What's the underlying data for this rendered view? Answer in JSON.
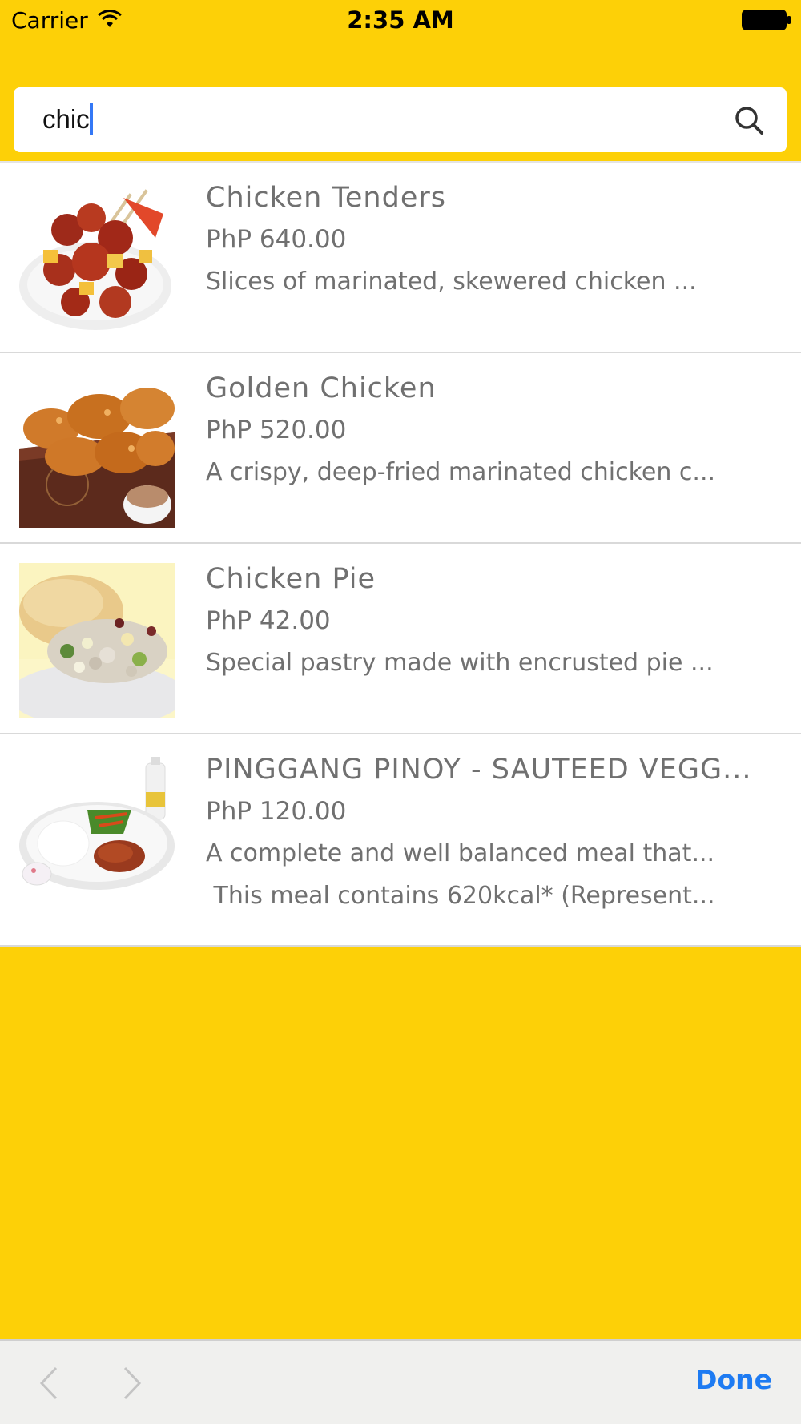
{
  "status_bar": {
    "carrier": "Carrier",
    "time": "2:35 AM"
  },
  "search": {
    "query": "chic",
    "icon": "search-icon"
  },
  "results": [
    {
      "name": "Chicken Tenders",
      "price": "PhP 640.00",
      "desc": [
        "Slices of marinated, skewered chicken ..."
      ]
    },
    {
      "name": "Golden Chicken",
      "price": "PhP 520.00",
      "desc": [
        "A crispy, deep-fried marinated chicken c..."
      ]
    },
    {
      "name": "Chicken Pie",
      "price": "PhP 42.00",
      "desc": [
        "Special pastry made with encrusted pie ..."
      ]
    },
    {
      "name": "PINGGANG PINOY - SAUTEED VEGG...",
      "price": "PhP 120.00",
      "desc": [
        "A complete and well balanced meal that...",
        " This meal contains 620kcal* (Represent..."
      ]
    }
  ],
  "toolbar": {
    "prev_icon": "chevron-left-icon",
    "next_icon": "chevron-right-icon",
    "done_label": "Done"
  },
  "colors": {
    "background": "#FDD007",
    "text_gray": "#707070",
    "accent_blue": "#1E7BF2"
  }
}
